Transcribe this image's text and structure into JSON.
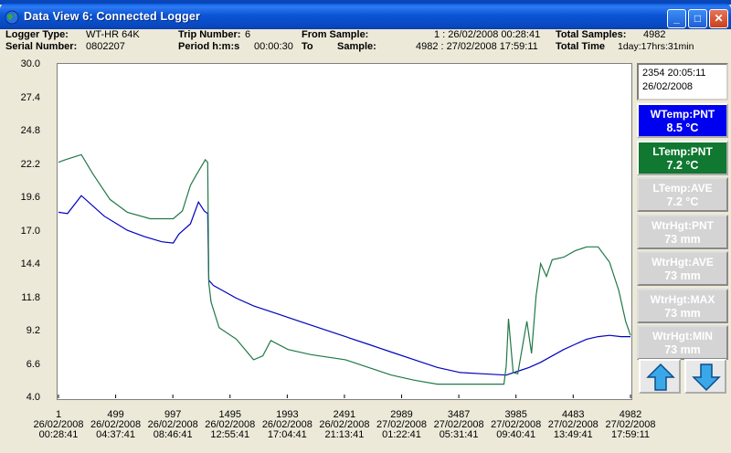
{
  "window": {
    "title": "Data View 6: Connected Logger",
    "minimize_glyph": "_",
    "maximize_glyph": "□",
    "close_glyph": "✕"
  },
  "info": {
    "logger_type_label": "Logger Type:",
    "logger_type": "WT-HR 64K",
    "serial_label": "Serial Number:",
    "serial": "0802207",
    "trip_label": "Trip Number:",
    "trip": "6",
    "period_label": "Period h:m:s",
    "period": "00:00:30",
    "from_label": "From Sample:",
    "from": "1 : 26/02/2008 00:28:41",
    "to_label": "To",
    "sample_label": "Sample:",
    "to": "4982 : 27/02/2008 17:59:11",
    "total_samples_label": "Total Samples:",
    "total_samples": "4982",
    "total_time_label": "Total Time",
    "total_time": "1day:17hrs:31min"
  },
  "cursor_readout": {
    "line1": "2354  20:05:11",
    "line2": "26/02/2008"
  },
  "channels": [
    {
      "name": "WTemp:PNT",
      "value": "8.5 °C",
      "style": "blue",
      "color": "#0000F0"
    },
    {
      "name": "LTemp:PNT",
      "value": "7.2 °C",
      "style": "green",
      "color": "#107830"
    },
    {
      "name": "LTemp:AVE",
      "value": "7.2 °C",
      "style": "grey"
    },
    {
      "name": "WtrHgt:PNT",
      "value": "73 mm",
      "style": "grey"
    },
    {
      "name": "WtrHgt:AVE",
      "value": "73 mm",
      "style": "grey"
    },
    {
      "name": "WtrHgt:MAX",
      "value": "73 mm",
      "style": "grey"
    },
    {
      "name": "WtrHgt:MIN",
      "value": "73 mm",
      "style": "grey"
    }
  ],
  "nav": {
    "up_icon": "up-arrow-icon",
    "down_icon": "down-arrow-icon"
  },
  "chart_data": {
    "type": "line",
    "ylim": [
      4.0,
      30.0
    ],
    "xlim": [
      1,
      4982
    ],
    "y_ticks": [
      "30.0",
      "27.4",
      "24.8",
      "22.2",
      "19.6",
      "17.0",
      "14.4",
      "11.8",
      "9.2",
      "6.6",
      "4.0"
    ],
    "x_ticks": [
      {
        "sample": "1",
        "date": "26/02/2008",
        "time": "00:28:41"
      },
      {
        "sample": "499",
        "date": "26/02/2008",
        "time": "04:37:41"
      },
      {
        "sample": "997",
        "date": "26/02/2008",
        "time": "08:46:41"
      },
      {
        "sample": "1495",
        "date": "26/02/2008",
        "time": "12:55:41"
      },
      {
        "sample": "1993",
        "date": "26/02/2008",
        "time": "17:04:41"
      },
      {
        "sample": "2491",
        "date": "26/02/2008",
        "time": "21:13:41"
      },
      {
        "sample": "2989",
        "date": "27/02/2008",
        "time": "01:22:41"
      },
      {
        "sample": "3487",
        "date": "27/02/2008",
        "time": "05:31:41"
      },
      {
        "sample": "3985",
        "date": "27/02/2008",
        "time": "09:40:41"
      },
      {
        "sample": "4483",
        "date": "27/02/2008",
        "time": "13:49:41"
      },
      {
        "sample": "4982",
        "date": "27/02/2008",
        "time": "17:59:11"
      }
    ],
    "series": [
      {
        "name": "WTemp:PNT",
        "color": "#0000C0",
        "x": [
          1,
          80,
          200,
          400,
          600,
          750,
          900,
          1000,
          1050,
          1150,
          1220,
          1270,
          1300,
          1310,
          1350,
          1450,
          1550,
          1700,
          1900,
          2100,
          2300,
          2500,
          2700,
          2900,
          3100,
          3300,
          3500,
          3700,
          3900,
          4000,
          4100,
          4200,
          4300,
          4400,
          4500,
          4600,
          4700,
          4800,
          4900,
          4982
        ],
        "y": [
          18.5,
          18.4,
          19.8,
          18.2,
          17.1,
          16.6,
          16.2,
          16.1,
          16.8,
          17.6,
          19.3,
          18.6,
          18.4,
          13.2,
          12.8,
          12.3,
          11.8,
          11.2,
          10.6,
          10.0,
          9.4,
          8.8,
          8.2,
          7.6,
          7.0,
          6.4,
          6.0,
          5.9,
          5.8,
          6.1,
          6.4,
          6.8,
          7.3,
          7.8,
          8.2,
          8.6,
          8.8,
          8.9,
          8.8,
          8.8
        ]
      },
      {
        "name": "LTemp:PNT",
        "color": "#207848",
        "x": [
          1,
          60,
          200,
          300,
          450,
          600,
          800,
          1000,
          1080,
          1150,
          1200,
          1280,
          1300,
          1310,
          1330,
          1400,
          1550,
          1700,
          1780,
          1850,
          2000,
          2200,
          2500,
          2700,
          2900,
          3100,
          3300,
          3500,
          3700,
          3880,
          3900,
          3920,
          3960,
          4000,
          4080,
          4120,
          4160,
          4200,
          4250,
          4300,
          4400,
          4500,
          4600,
          4700,
          4800,
          4880,
          4940,
          4982
        ],
        "y": [
          22.4,
          22.6,
          23.0,
          21.5,
          19.5,
          18.5,
          18.0,
          18.0,
          18.6,
          20.6,
          21.4,
          22.6,
          22.4,
          13.0,
          11.5,
          9.5,
          8.6,
          7.0,
          7.3,
          8.5,
          7.8,
          7.4,
          7.0,
          6.4,
          5.8,
          5.4,
          5.1,
          5.1,
          5.1,
          5.1,
          6.5,
          10.2,
          6.0,
          5.9,
          10.0,
          7.5,
          12.0,
          14.5,
          13.5,
          14.8,
          15.0,
          15.5,
          15.8,
          15.8,
          14.6,
          12.4,
          10.0,
          8.9
        ]
      }
    ]
  }
}
